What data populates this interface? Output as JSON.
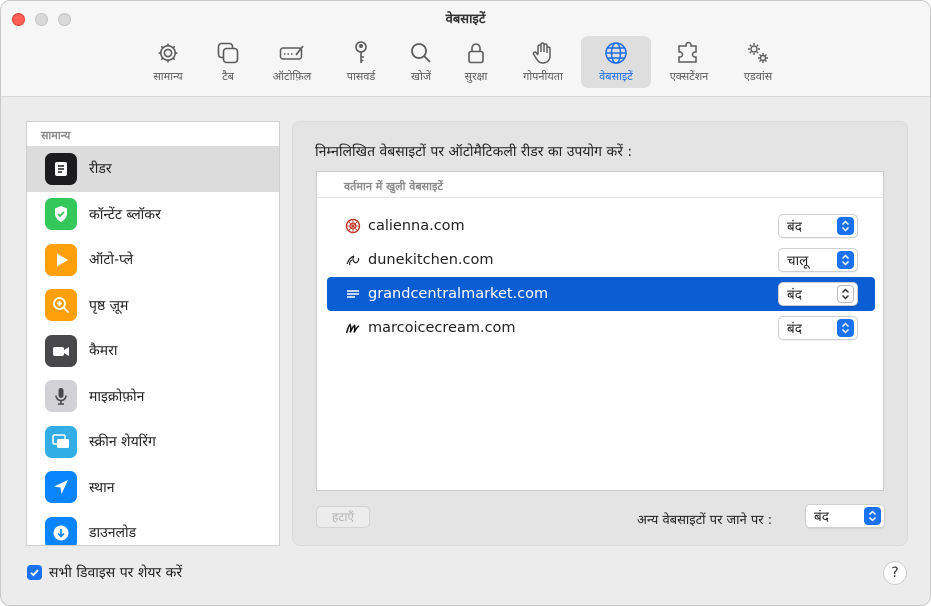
{
  "window": {
    "title": "वेबसाइटें"
  },
  "toolbar": {
    "items": [
      {
        "label": "सामान्य",
        "icon": "gear-icon"
      },
      {
        "label": "टैब",
        "icon": "tabs-icon"
      },
      {
        "label": "ऑटोफ़िल",
        "icon": "autofill-icon"
      },
      {
        "label": "पासवर्ड",
        "icon": "key-icon"
      },
      {
        "label": "खोजें",
        "icon": "search-icon"
      },
      {
        "label": "सुरक्षा",
        "icon": "lock-icon"
      },
      {
        "label": "गोपनीयता",
        "icon": "hand-icon"
      },
      {
        "label": "वेबसाइटें",
        "icon": "globe-icon",
        "active": true
      },
      {
        "label": "एक्सटेंशन",
        "icon": "puzzle-icon"
      },
      {
        "label": "एडवांस",
        "icon": "gears-icon"
      }
    ]
  },
  "sidebar": {
    "header": "सामान्य",
    "items": [
      {
        "label": "रीडर",
        "icon": "reader-icon",
        "color": "#1c1c1e",
        "selected": true
      },
      {
        "label": "कॉन्टेंट ब्लॉकर",
        "icon": "shield-check-icon",
        "color": "#34c759"
      },
      {
        "label": "ऑटो-प्ले",
        "icon": "play-icon",
        "color": "#ff9f0a"
      },
      {
        "label": "पृष्ठ ज़ूम",
        "icon": "zoom-icon",
        "color": "#ff9f0a"
      },
      {
        "label": "कैमरा",
        "icon": "camera-icon",
        "color": "#48484a"
      },
      {
        "label": "माइक्रोफ़ोन",
        "icon": "microphone-icon",
        "color": "#d1d1d6"
      },
      {
        "label": "स्क्रीन शेयरिंग",
        "icon": "screen-sharing-icon",
        "color": "#32ade6"
      },
      {
        "label": "स्थान",
        "icon": "location-icon",
        "color": "#0a84ff"
      },
      {
        "label": "डाउनलोड",
        "icon": "download-icon",
        "color": "#0a84ff"
      }
    ]
  },
  "panel": {
    "heading": "निम्नलिखित वेबसाइटों पर ऑटोमैटिकली रीडर का उपयोग करें :",
    "table_header": "वर्तमान में खुली वेबसाइटें",
    "sites": [
      {
        "name": "calienna.com",
        "setting": "बंद",
        "icon": "calienna-favicon-icon"
      },
      {
        "name": "dunekitchen.com",
        "setting": "चालू",
        "icon": "dunekitchen-favicon-icon"
      },
      {
        "name": "grandcentralmarket.com",
        "setting": "बंद",
        "icon": "grandcentral-favicon-icon",
        "selected": true
      },
      {
        "name": "marcoicecream.com",
        "setting": "बंद",
        "icon": "marco-favicon-icon"
      }
    ],
    "remove_label": "हटाएँ",
    "other_label": "अन्य वेबसाइटों पर जाने पर :",
    "other_value": "बंद"
  },
  "footer": {
    "share_label": "सभी डिवाइस पर शेयर करें",
    "share_checked": true,
    "help_label": "?"
  },
  "colors": {
    "accent": "#1a72f0",
    "selection": "#0a5dd2"
  }
}
